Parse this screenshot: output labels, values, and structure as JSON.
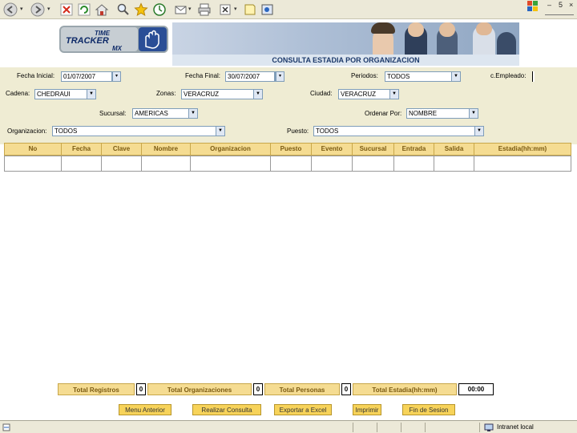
{
  "page": {
    "title": "CONSULTA ESTADIA POR ORGANIZACION",
    "logo": [
      "TIME",
      "TRACKER",
      "MX"
    ]
  },
  "filters": {
    "fecha_inicial": {
      "label": "Fecha Inicial:",
      "value": "01/07/2007"
    },
    "fecha_final": {
      "label": "Fecha Final:",
      "value": "30/07/2007"
    },
    "periodos": {
      "label": "Periodos:",
      "value": "TODOS"
    },
    "empleado": {
      "label": "c.Empleado:",
      "value": ""
    },
    "cadena": {
      "label": "Cadena:",
      "value": "CHEDRAUI"
    },
    "zonas": {
      "label": "Zonas:",
      "value": "VERACRUZ"
    },
    "ciudad": {
      "label": "Ciudad:",
      "value": "VERACRUZ"
    },
    "sucursal": {
      "label": "Sucursal:",
      "value": "AMERICAS"
    },
    "ordenar_por": {
      "label": "Ordenar Por:",
      "value": "NOMBRE"
    },
    "organizacion": {
      "label": "Organizacion:",
      "value": "TODOS"
    },
    "puesto": {
      "label": "Puesto:",
      "value": "TODOS"
    }
  },
  "grid": {
    "columns": [
      "No",
      "Fecha",
      "Clave",
      "Nombre",
      "Organizacion",
      "Puesto",
      "Evento",
      "Sucursal",
      "Entrada",
      "Salida",
      "Estadia(hh:mm)"
    ]
  },
  "totals": {
    "registros": {
      "label": "Total Registros",
      "value": "0"
    },
    "organizaciones": {
      "label": "Total Organizaciones",
      "value": "0"
    },
    "personas": {
      "label": "Total Personas",
      "value": "0"
    },
    "estadia": {
      "label": "Total Estadia(hh:mm)",
      "value": "00:00"
    }
  },
  "actions": {
    "menu_anterior": "Menu Anterior",
    "realizar_consulta": "Realizar Consulta",
    "exportar_excel": "Exportar a Excel",
    "imprimir": "Imprimir",
    "fin_sesion": "Fin de Sesion"
  },
  "statusbar": {
    "zone": "Intranet local"
  },
  "colors": {
    "filter_band": "#efecd3",
    "header_gold": "#f5dc92",
    "button_gold": "#f7d35a",
    "title_blue": "#1d3a6b"
  }
}
